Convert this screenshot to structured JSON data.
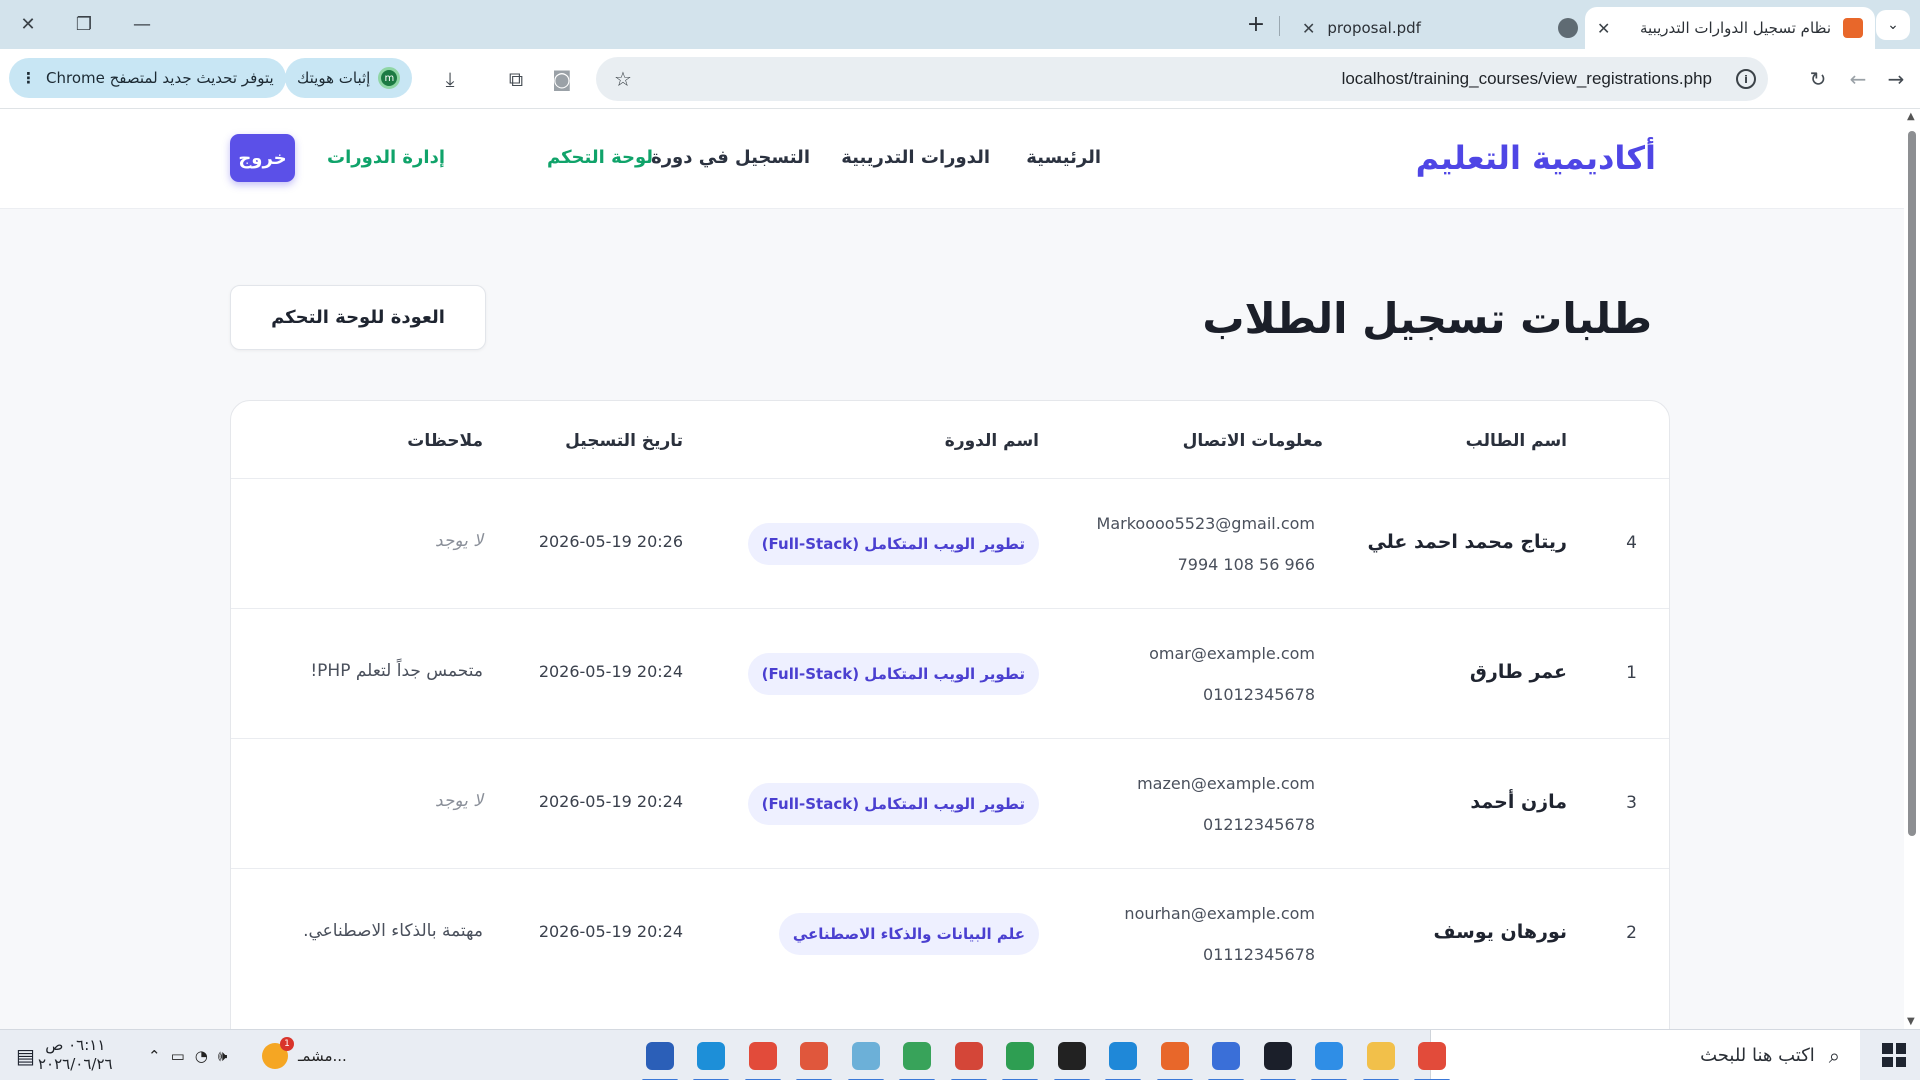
{
  "browser": {
    "tabs": [
      {
        "title": "نظام تسجيل الدوارات التدريبية",
        "active": true,
        "favicon_color": "#e8672a"
      },
      {
        "title": "proposal.pdf",
        "active": false,
        "favicon_color": "#5f6b73"
      }
    ],
    "url": "localhost/training_courses/view_registrations.php",
    "profile_pill": "إثبات هويتك",
    "update_pill": "يتوفر تحديث جديد لمتصفح Chrome",
    "icons": [
      "close-icon",
      "restore-icon",
      "minimize-icon",
      "new-tab-icon",
      "tab-search-icon",
      "forward-icon",
      "back-icon",
      "reload-icon",
      "info-icon",
      "star-icon",
      "screenshot-icon",
      "extensions-icon",
      "download-icon",
      "kebab-menu-icon"
    ]
  },
  "site": {
    "brand": "أكاديمية التعليم",
    "nav": {
      "home": "الرئيسية",
      "courses": "الدورات التدريبية",
      "register": "التسجيل في دورة",
      "dashboard": "لوحة التحكم",
      "manage": "إدارة الدورات",
      "logout": "خروج"
    },
    "accent": "#4f46e5",
    "nav_green": "#10a36a"
  },
  "main": {
    "title": "طلبات تسجيل الطلاب",
    "back_button": "العودة للوحة التحكم",
    "table": {
      "headers": {
        "name": "اسم الطالب",
        "contact": "معلومات الاتصال",
        "course": "اسم الدورة",
        "date": "تاريخ التسجيل",
        "notes": "ملاحظات"
      },
      "rows": [
        {
          "id": "4",
          "name": "ريتاج محمد احمد علي",
          "email": "Markoooo5523@gmail.com",
          "phone": "7994 108 56 966",
          "course": "تطوير الويب المتكامل (Full-Stack)",
          "date": "2026-05-19 20:26",
          "note": "لا يوجد",
          "note_empty": true
        },
        {
          "id": "1",
          "name": "عمر طارق",
          "email": "omar@example.com",
          "phone": "01012345678",
          "course": "تطوير الويب المتكامل (Full-Stack)",
          "date": "2026-05-19 20:24",
          "note": "متحمس جداً لتعلم PHP!",
          "note_empty": false
        },
        {
          "id": "3",
          "name": "مازن أحمد",
          "email": "mazen@example.com",
          "phone": "01212345678",
          "course": "تطوير الويب المتكامل (Full-Stack)",
          "date": "2026-05-19 20:24",
          "note": "لا يوجد",
          "note_empty": true
        },
        {
          "id": "2",
          "name": "نورهان يوسف",
          "email": "nourhan@example.com",
          "phone": "01112345678",
          "course": "علم البيانات والذكاء الاصطناعي",
          "date": "2026-05-19 20:24",
          "note": "مهتمة بالذكاء الاصطناعي.",
          "note_empty": false
        }
      ]
    }
  },
  "taskbar": {
    "search_placeholder": "اكتب هنا للبحث",
    "weather_label": "مشمـ...",
    "time": "٠٦:١١ ص",
    "date": "٢٠٢٦/٠٦/٢٦",
    "notification_badge": "1",
    "apps": [
      {
        "name": "chrome-icon",
        "color": "#e24b3a"
      },
      {
        "name": "file-explorer-icon",
        "color": "#f2c04a"
      },
      {
        "name": "arduino-icon",
        "color": "#2f8ee6"
      },
      {
        "name": "terminal-app-icon",
        "color": "#1b1f2a"
      },
      {
        "name": "android-studio-icon",
        "color": "#3a6fd8"
      },
      {
        "name": "xampp-icon",
        "color": "#e8672a"
      },
      {
        "name": "vscode-icon",
        "color": "#1f88d8"
      },
      {
        "name": "cmd-icon",
        "color": "#222"
      },
      {
        "name": "chrome-profile-icon",
        "color": "#2e9e52"
      },
      {
        "name": "chrome-alt-icon",
        "color": "#d44638"
      },
      {
        "name": "chrome-green-icon",
        "color": "#38a35a"
      },
      {
        "name": "notepad-icon",
        "color": "#6cb0d8"
      },
      {
        "name": "paint-icon",
        "color": "#e0573c"
      },
      {
        "name": "chrome-main-icon",
        "color": "#e24b3a"
      },
      {
        "name": "edge-icon",
        "color": "#1d8fd8"
      },
      {
        "name": "word-icon",
        "color": "#2b5fb8"
      }
    ]
  }
}
